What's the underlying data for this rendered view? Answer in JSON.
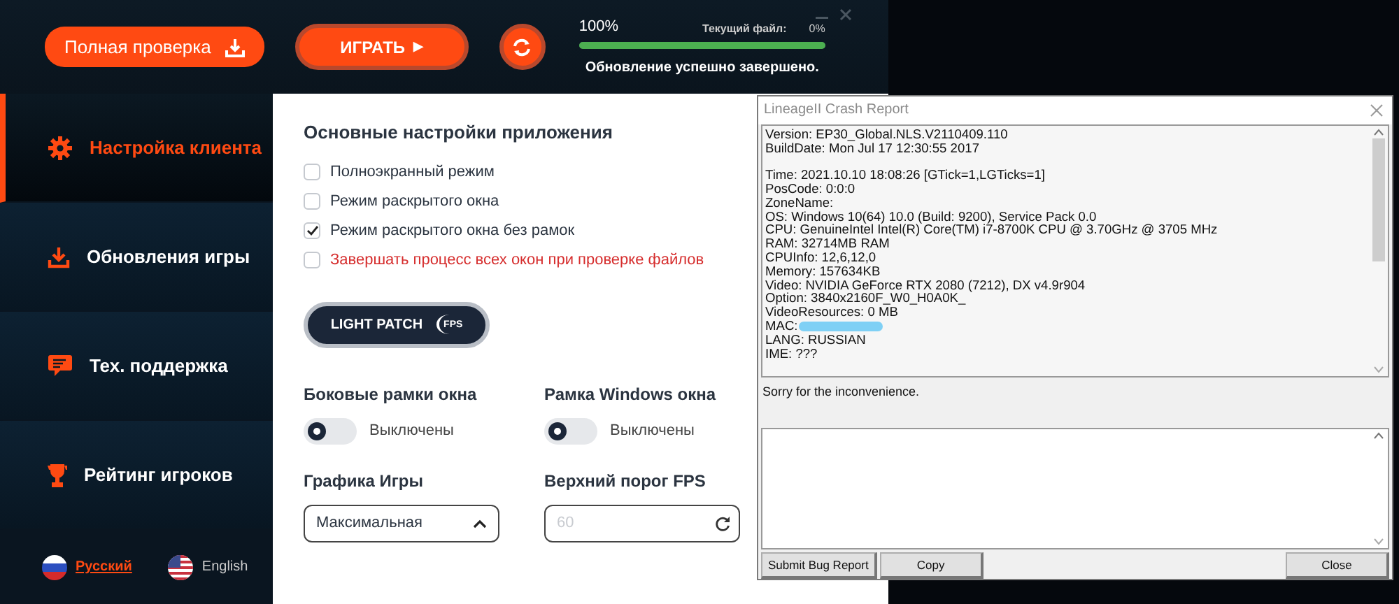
{
  "launcher": {
    "top_bar": {
      "full_check_button": "Полная проверка",
      "play_button": {
        "label": "ИГРАТЬ",
        "arrow": "▶"
      },
      "progress": {
        "percent": "100%",
        "current_file_label": "Текущий файл:",
        "current_file_percent": "0%",
        "level": 1,
        "status": "Обновление успешно завершено."
      }
    },
    "sidebar": {
      "items": [
        {
          "label": "Настройка клиента",
          "kind": "settings",
          "selected": true
        },
        {
          "label": "Обновления игры",
          "kind": "download",
          "selected": false
        },
        {
          "label": "Тех. поддержка",
          "kind": "support",
          "selected": false
        },
        {
          "label": "Рейтинг игроков",
          "kind": "rating",
          "selected": false
        }
      ],
      "languages": [
        {
          "label": "Русский",
          "kind": "russia",
          "selected": true
        },
        {
          "label": "English",
          "kind": "usa",
          "selected": false
        }
      ]
    },
    "settings": {
      "title": "Основные настройки приложения",
      "checkboxes": [
        {
          "label": "Полноэкранный режим",
          "checked": false,
          "warning": false
        },
        {
          "label": "Режим раскрытого окна",
          "checked": false,
          "warning": false
        },
        {
          "label": "Режим раскрытого окна без рамок",
          "checked": true,
          "warning": false
        },
        {
          "label": "Завершать процесс всех окон при проверке файлов",
          "checked": false,
          "warning": true
        }
      ],
      "light_patch": {
        "label": "LIGHT PATCH",
        "badge": "FPS"
      },
      "toggles": [
        {
          "title": "Боковые рамки окна",
          "state_label": "Выключены",
          "on": false
        },
        {
          "title": "Рамка Windows окна",
          "state_label": "Выключены",
          "on": false
        }
      ],
      "graphics": {
        "title": "Графика Игры",
        "value": "Максимальная",
        "expanded": true
      },
      "fps": {
        "title": "Верхний порог FPS",
        "placeholder": "60"
      }
    }
  },
  "crash_report": {
    "title": "LineageII Crash Report",
    "blocks": [
      [
        {
          "text": "Version: EP30_Global.NLS.V2110409.110"
        },
        {
          "text": "BuildDate: Mon Jul 17 12:30:55 2017"
        }
      ],
      [
        {
          "text": "Time: 2021.10.10 18:08:26 [GTick=1,LGTicks=1]"
        },
        {
          "text": "PosCode: 0:0:0"
        },
        {
          "text": "ZoneName:"
        },
        {
          "text": "OS: Windows 10(64) 10.0 (Build: 9200), Service Pack 0.0"
        },
        {
          "text": "CPU: GenuineIntel  Intel(R) Core(TM) i7-8700K CPU @ 3.70GHz @ 3705 MHz"
        },
        {
          "text": "RAM: 32714MB RAM"
        },
        {
          "text": "CPUInfo: 12,6,12,0"
        },
        {
          "text": "Memory: 157634KB"
        },
        {
          "text": "Video: NVIDIA GeForce RTX 2080 (7212), DX v4.9r904"
        },
        {
          "text": "Option: 3840x2160F_W0_H0A0K_"
        },
        {
          "text": "VideoResources: 0 MB"
        },
        {
          "text": "MAC:",
          "redacted": true
        },
        {
          "text": "LANG: RUSSIAN"
        },
        {
          "text": "IME: ???"
        }
      ]
    ],
    "message": "Sorry for the inconvenience.",
    "buttons": [
      "Submit Bug Report",
      "Copy",
      "Close"
    ]
  }
}
